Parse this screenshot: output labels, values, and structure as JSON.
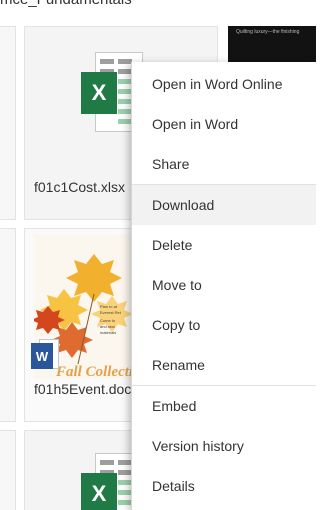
{
  "folder": {
    "title": "mce_Fundamentals"
  },
  "files": [
    {
      "name": "f01c1Cost.xlsx",
      "type": "excel-icon"
    },
    {
      "name": "f01h5Event.doc",
      "type": "word-icon"
    }
  ],
  "thumb_dark": {
    "caption": "Quilting luxury—the finishing"
  },
  "flyer": {
    "headline": "Fall Collection",
    "body_lines": [
      "Plan to at",
      "Everest Ret",
      "Come to",
      "and sew",
      "materials"
    ]
  },
  "context_menu": {
    "hovered_index": 3,
    "items": [
      {
        "label": "Open in Word Online"
      },
      {
        "label": "Open in Word"
      },
      {
        "label": "Share"
      },
      {
        "label": "Download"
      },
      {
        "label": "Delete"
      },
      {
        "label": "Move to"
      },
      {
        "label": "Copy to"
      },
      {
        "label": "Rename"
      },
      {
        "label": "Embed"
      },
      {
        "label": "Version history"
      },
      {
        "label": "Details"
      }
    ]
  },
  "colors": {
    "excel_green": "#1f7a45",
    "word_blue": "#2b579a",
    "menu_hover": "#f2f2f2"
  }
}
